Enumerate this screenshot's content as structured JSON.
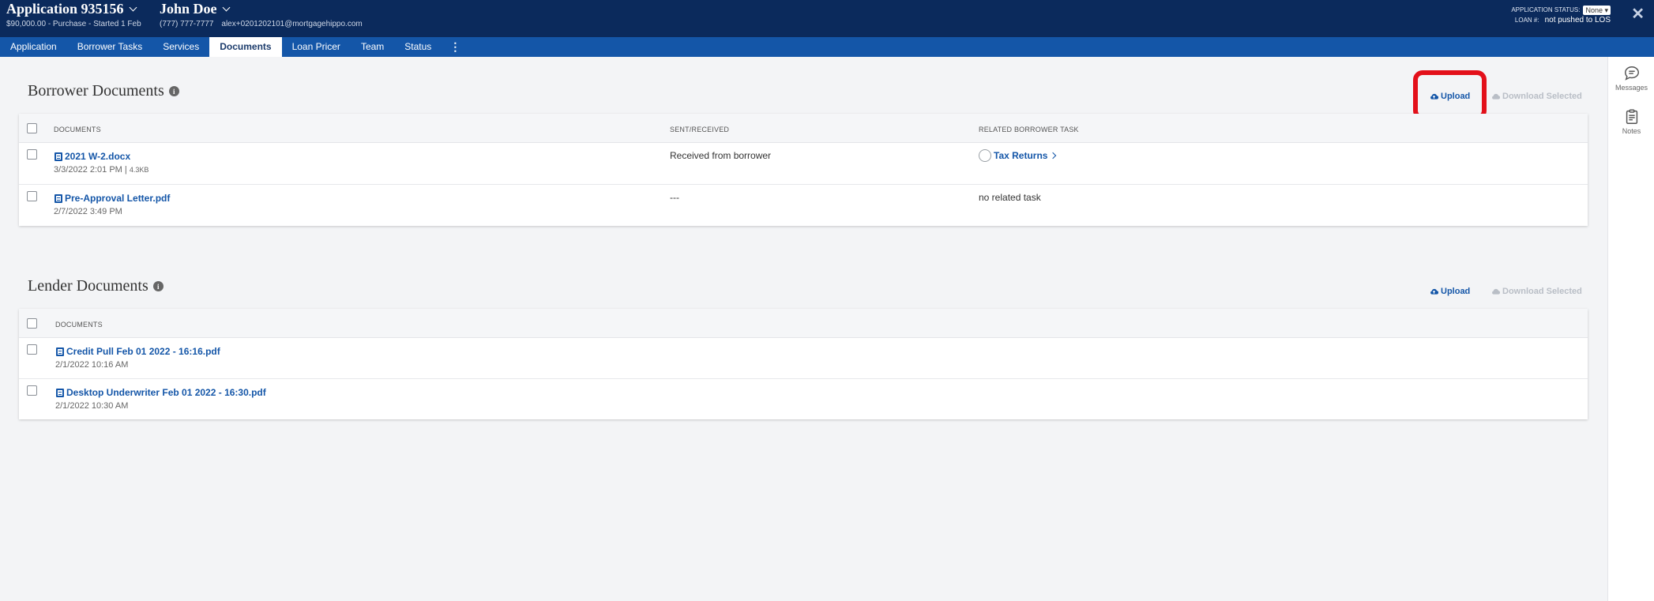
{
  "header": {
    "app_title": "Application 935156",
    "app_sub": "$90,000.00 - Purchase - Started 1 Feb",
    "person_name": "John Doe",
    "person_phone": "(777) 777-7777",
    "person_email": "alex+0201202101@mortgagehippo.com",
    "status_label": "APPLICATION STATUS:",
    "status_value": "None",
    "loan_label": "LOAN #:",
    "loan_value": "not pushed to LOS",
    "close": "✕"
  },
  "tabs": [
    {
      "label": "Application"
    },
    {
      "label": "Borrower Tasks"
    },
    {
      "label": "Services"
    },
    {
      "label": "Documents"
    },
    {
      "label": "Loan Pricer"
    },
    {
      "label": "Team"
    },
    {
      "label": "Status"
    }
  ],
  "tabs_more": "⋮",
  "rail": {
    "messages": "Messages",
    "notes": "Notes"
  },
  "borrower_docs": {
    "title": "Borrower Documents",
    "upload": "Upload",
    "download": "Download Selected",
    "col_documents": "DOCUMENTS",
    "col_sent": "SENT/RECEIVED",
    "col_task": "RELATED BORROWER TASK",
    "rows": [
      {
        "name": "2021 W-2.docx",
        "date": "3/3/2022 2:01 PM",
        "size": "4.3KB",
        "sent": "Received from borrower",
        "task": "Tax Returns"
      },
      {
        "name": "Pre-Approval Letter.pdf",
        "date": "2/7/2022 3:49 PM",
        "sent": "---",
        "task": "no related task"
      }
    ]
  },
  "lender_docs": {
    "title": "Lender Documents",
    "upload": "Upload",
    "download": "Download Selected",
    "col_documents": "DOCUMENTS",
    "rows": [
      {
        "name": "Credit Pull Feb 01 2022 - 16:16.pdf",
        "date": "2/1/2022 10:16 AM"
      },
      {
        "name": "Desktop Underwriter Feb 01 2022 - 16:30.pdf",
        "date": "2/1/2022 10:30 AM"
      }
    ]
  },
  "colors": {
    "header_bg": "#0b2a5c",
    "tab_bg": "#1456a8",
    "link": "#1456a8",
    "highlight": "#e3101a"
  }
}
